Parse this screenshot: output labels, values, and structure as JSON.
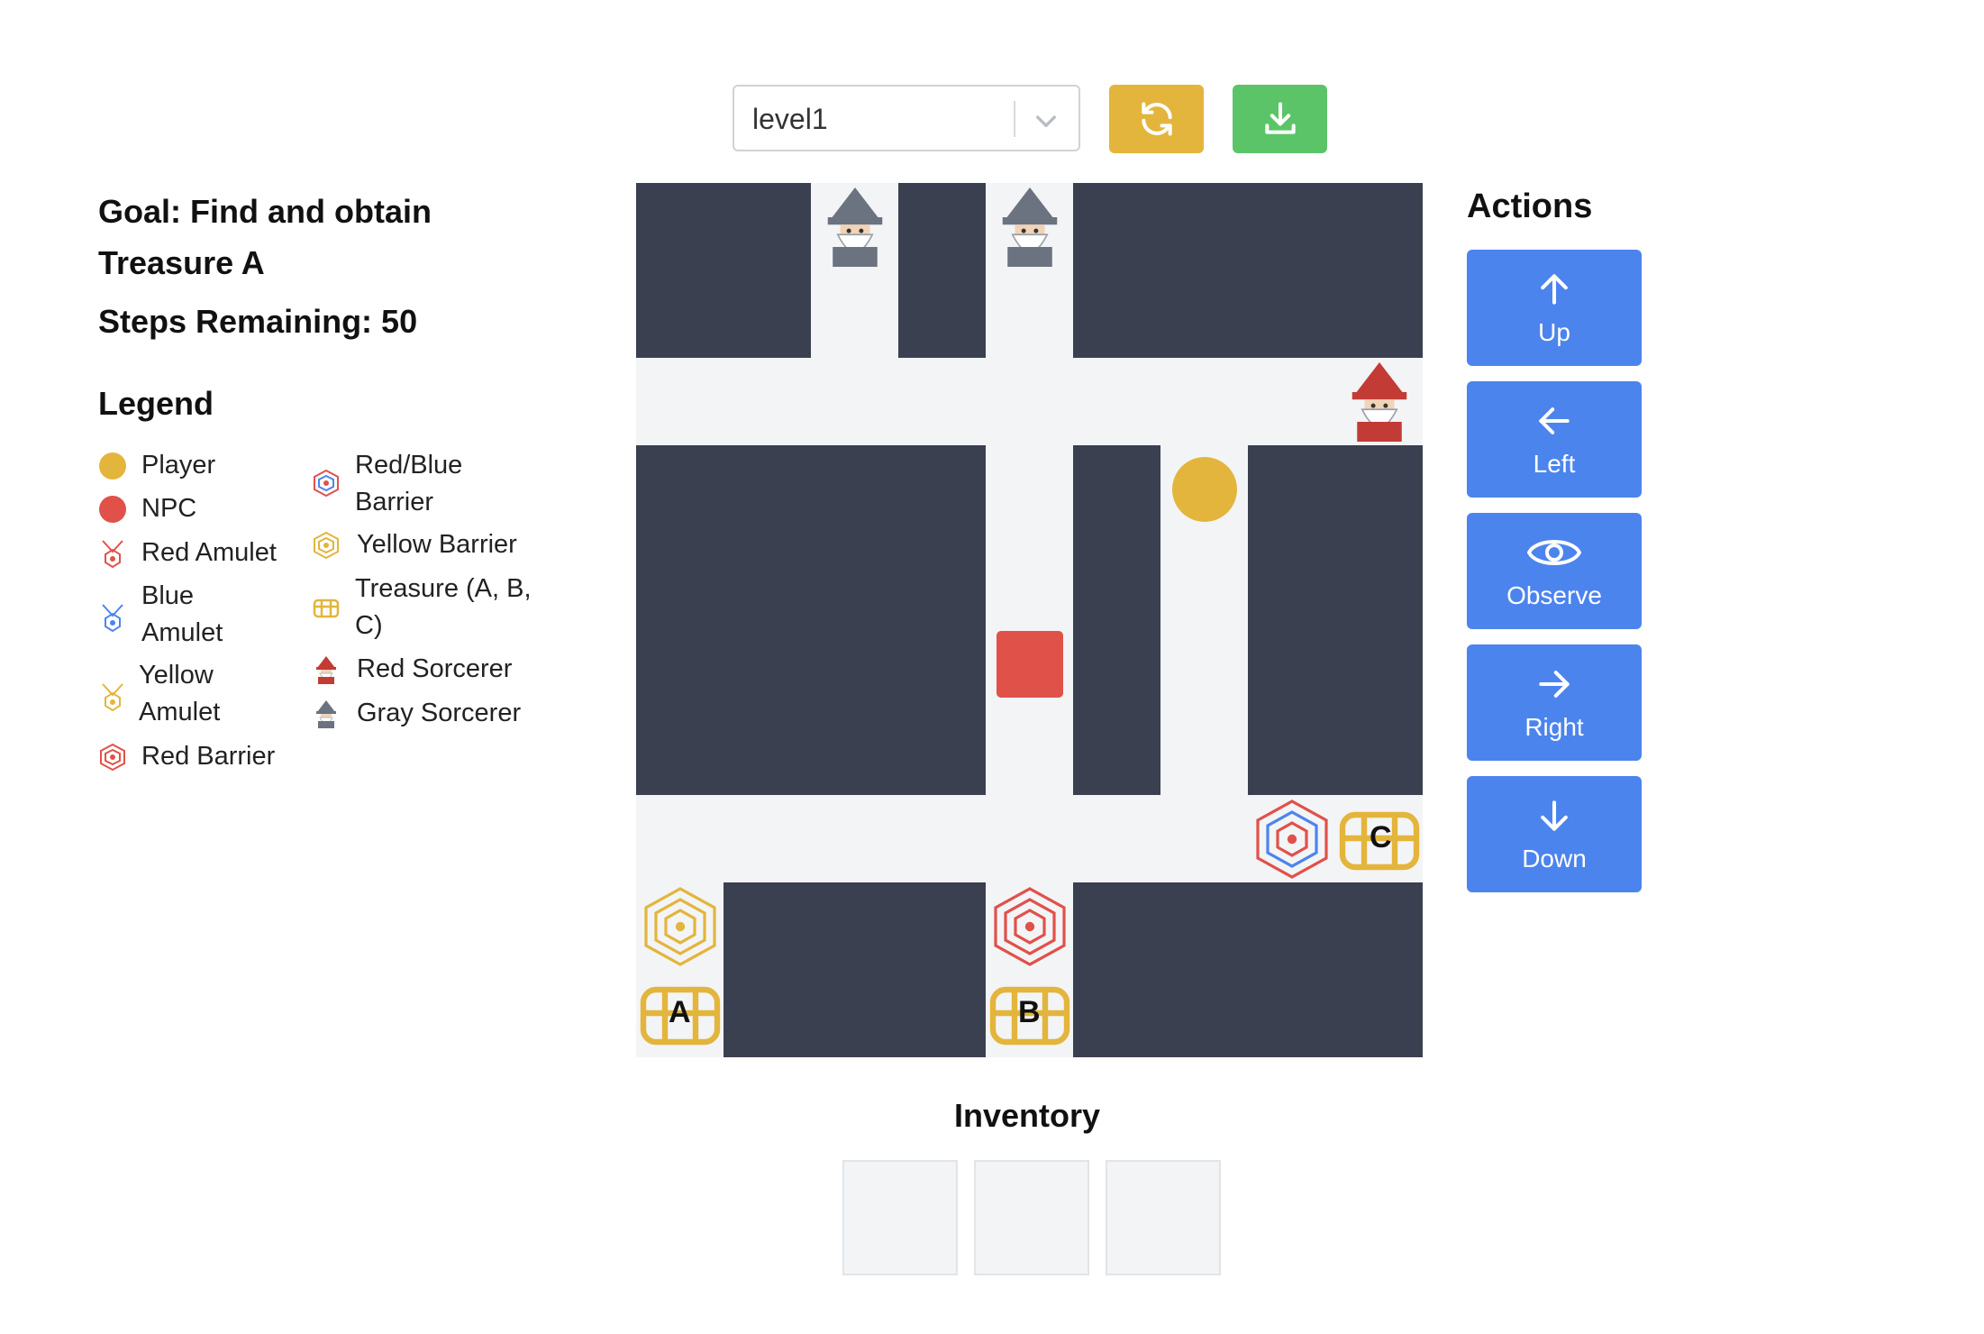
{
  "level_select": {
    "value": "level1"
  },
  "toolbar": {
    "reset_icon": "refresh-icon",
    "download_icon": "download-icon"
  },
  "goal": {
    "text": "Goal: Find and obtain Treasure A"
  },
  "steps": {
    "text": "Steps Remaining: 50"
  },
  "legend": {
    "title": "Legend",
    "items": [
      {
        "label": "Player",
        "icon": "player-dot"
      },
      {
        "label": "NPC",
        "icon": "npc-dot"
      },
      {
        "label": "Red Amulet",
        "icon": "red-amulet-icon"
      },
      {
        "label": "Blue Amulet",
        "icon": "blue-amulet-icon"
      },
      {
        "label": "Yellow Amulet",
        "icon": "yellow-amulet-icon"
      },
      {
        "label": "Red Barrier",
        "icon": "red-barrier-icon"
      },
      {
        "label": "Red/Blue Barrier",
        "icon": "red-blue-barrier-icon"
      },
      {
        "label": "Yellow Barrier",
        "icon": "yellow-barrier-icon"
      },
      {
        "label": "Treasure (A, B, C)",
        "icon": "treasure-icon"
      },
      {
        "label": "Red Sorcerer",
        "icon": "red-sorcerer-icon"
      },
      {
        "label": "Gray Sorcerer",
        "icon": "gray-sorcerer-icon"
      }
    ]
  },
  "grid": {
    "treasures": [
      {
        "label": "A"
      },
      {
        "label": "B"
      },
      {
        "label": "C"
      }
    ]
  },
  "actions": {
    "title": "Actions",
    "buttons": [
      {
        "label": "Up",
        "icon": "arrow-up-icon"
      },
      {
        "label": "Left",
        "icon": "arrow-left-icon"
      },
      {
        "label": "Observe",
        "icon": "eye-icon"
      },
      {
        "label": "Right",
        "icon": "arrow-right-icon"
      },
      {
        "label": "Down",
        "icon": "arrow-down-icon"
      }
    ]
  },
  "inventory": {
    "title": "Inventory",
    "slots": [
      "",
      "",
      ""
    ]
  },
  "colors": {
    "wall": "#3a4050",
    "floor": "#f3f4f6",
    "player": "#e3b53c",
    "npc": "#e0514a",
    "action_button": "#4c84ee",
    "reset_button": "#e3b53c",
    "download_button": "#5cc468"
  }
}
